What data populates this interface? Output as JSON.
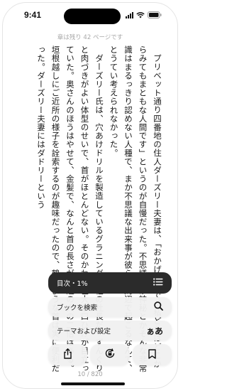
{
  "status_bar": {
    "time": "9:41"
  },
  "header": {
    "remaining": "章は残り 42 ページです"
  },
  "book": {
    "paragraphs": [
      "プリベット通り四番地の住人ダーズリー夫妻は、「おかげさまで、私どもはどこからみてもまともな人間です」というのが自慢だった。不思議とか神秘とかそんな非常識はまるっきり認めない人種で、まか不思議な出来事が彼らの周辺で起こるなんて、とうてい考えられなかった。",
      "ダーズリー氏は、穴あけドリルを製造しているグラニングズ社の社長だ。ずんぐりと肉づきがよい体型のせいで、首がほとんどない。そのかわり巨大な口ひげが目立っていた。奥さんのほうはやせて、金髪で、なんと首の長さが普通の人の二倍はある。垣根越しにご近所の様子を詮索するのが趣味だったので、鶴のような首は実に便利だった。ダーズリー夫妻にはダドリーという"
    ]
  },
  "menu": {
    "toc_label": "目次・1%",
    "search_label": "ブックを検索",
    "theme_label": "テーマおよび設定",
    "theme_icon_text": "ぁあ"
  },
  "footer": {
    "page_number": "10 / 820"
  }
}
